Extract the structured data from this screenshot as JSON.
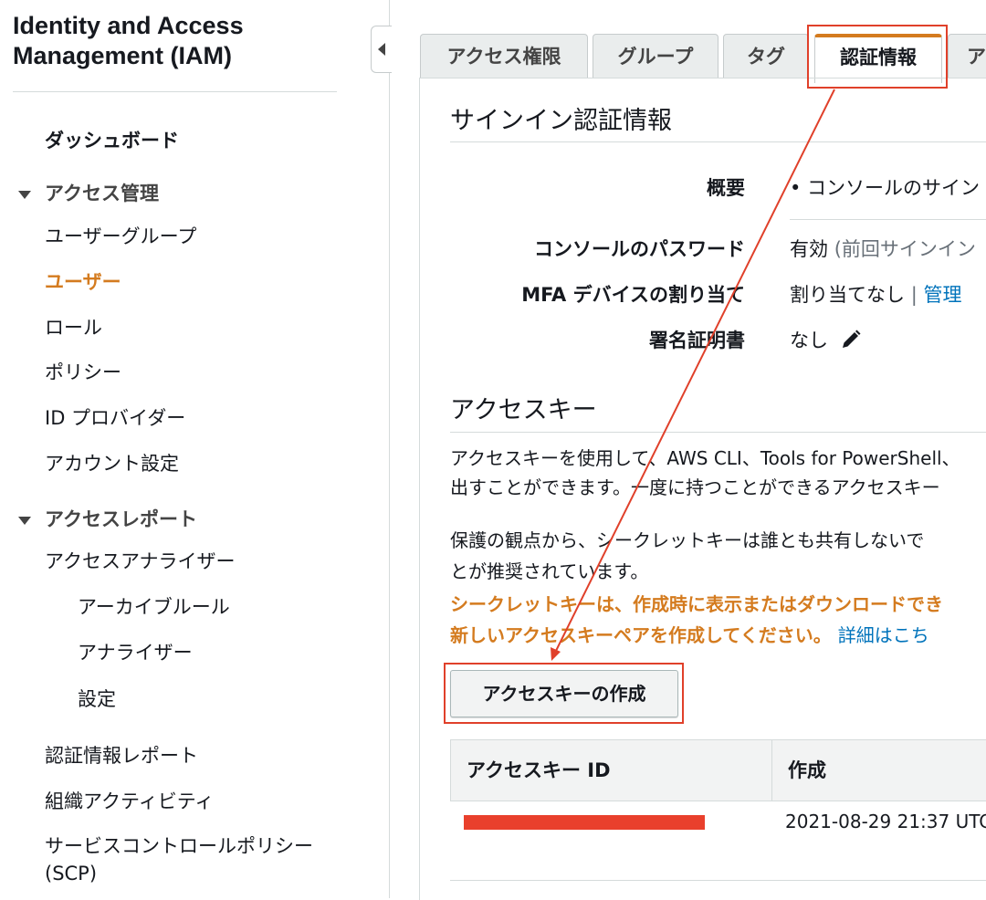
{
  "sidebar": {
    "title_line1": "Identity and Access",
    "title_line2": "Management (IAM)",
    "dashboard": "ダッシュボード",
    "access_mgmt": "アクセス管理",
    "items": [
      "ユーザーグループ",
      "ユーザー",
      "ロール",
      "ポリシー",
      "ID プロバイダー",
      "アカウント設定"
    ],
    "active_item": "ユーザー",
    "access_reports": "アクセスレポート",
    "report_items": [
      "アクセスアナライザー",
      "アーカイブルール",
      "アナライザー",
      "設定",
      "認証情報レポート",
      "組織アクティビティ"
    ],
    "scp_line1": "サービスコントロールポリシー",
    "scp_line2": "(SCP)"
  },
  "tabs": [
    "アクセス権限",
    "グループ",
    "タグ",
    "認証情報",
    "ア"
  ],
  "active_tab": "認証情報",
  "signin": {
    "heading": "サインイン認証情報",
    "summary_label": "概要",
    "summary_value": "• コンソールのサイン",
    "password_label": "コンソールのパスワード",
    "password_value": "有効",
    "password_note": "(前回サインイン",
    "mfa_label": "MFA デバイスの割り当て",
    "mfa_value": "割り当てなし",
    "mfa_sep": "|",
    "mfa_link": "管理",
    "cert_label": "署名証明書",
    "cert_value": "なし"
  },
  "access_keys": {
    "heading": "アクセスキー",
    "para1_line1": "アクセスキーを使用して、AWS CLI、Tools for PowerShell、",
    "para1_line2": "出すことができます。一度に持つことができるアクセスキー",
    "para2_line1": "保護の観点から、シークレットキーは誰とも共有しないで",
    "para2_line2": "とが推奨されています。",
    "warn_line1": "シークレットキーは、作成時に表示またはダウンロードでき",
    "warn_line2": "新しいアクセスキーペアを作成してください。",
    "details_link": "詳細はこち",
    "create_button": "アクセスキーの作成",
    "table_headers": [
      "アクセスキー ID",
      "作成"
    ],
    "rows": [
      {
        "id": "",
        "created": "2021-08-29 21:37 UTC"
      }
    ]
  },
  "colors": {
    "accent": "#d47b1f",
    "annotation": "#e0402a",
    "link": "#0073bb"
  }
}
